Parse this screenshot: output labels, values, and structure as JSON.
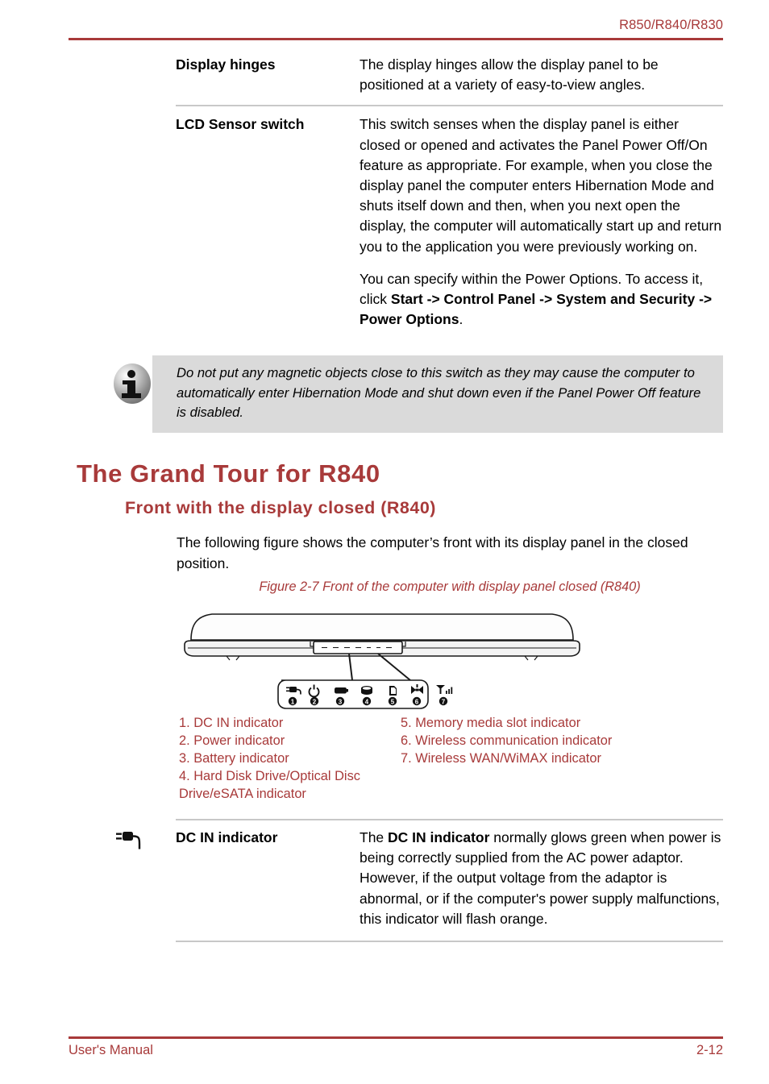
{
  "header": {
    "model_line": "R850/R840/R830",
    "accent_color": "#a83a3a"
  },
  "spec_table": {
    "rows": [
      {
        "term": "Display hinges",
        "paragraphs": [
          {
            "segments": [
              {
                "text": "The display hinges allow the display panel to be positioned at a variety of easy-to-view angles.",
                "bold": false
              }
            ]
          }
        ]
      },
      {
        "term": "LCD Sensor switch",
        "paragraphs": [
          {
            "segments": [
              {
                "text": "This switch senses when the display panel is either closed or opened and activates the Panel Power Off/On feature as appropriate. For example, when you close the display panel the computer enters Hibernation Mode and shuts itself down and then, when you next open the display, the computer will automatically start up and return you to the application you were previously working on.",
                "bold": false
              }
            ]
          },
          {
            "segments": [
              {
                "text": "You can specify within the Power Options. To access it, click ",
                "bold": false
              },
              {
                "text": "Start -> Control Panel -> System and Security -> Power Options",
                "bold": true
              },
              {
                "text": ".",
                "bold": false
              }
            ]
          }
        ]
      }
    ]
  },
  "note": {
    "icon": "info-icon",
    "background_color": "#dadada",
    "text": "Do not put any magnetic objects close to this switch as they may cause the computer to automatically enter Hibernation Mode and shut down even if the Panel Power Off feature is disabled."
  },
  "headings": {
    "h1": "The Grand Tour for R840",
    "h2": "Front with the display closed (R840)"
  },
  "intro": "The following figure shows the computer’s front with its display panel in the closed position.",
  "figure": {
    "caption": "Figure 2-7 Front of the computer with display panel closed (R840)",
    "indicator_icons": [
      {
        "number": "1",
        "icon": "ac-plug-icon"
      },
      {
        "number": "2",
        "icon": "power-icon"
      },
      {
        "number": "3",
        "icon": "battery-icon"
      },
      {
        "number": "4",
        "icon": "hard-disk-icon"
      },
      {
        "number": "5",
        "icon": "memory-card-icon"
      },
      {
        "number": "6",
        "icon": "wireless-icon"
      },
      {
        "number": "7",
        "icon": "signal-bars-icon"
      }
    ]
  },
  "legend": {
    "left_column": [
      "1. DC IN indicator",
      "2. Power indicator",
      "3. Battery indicator",
      "4. Hard Disk Drive/Optical Disc Drive/eSATA indicator"
    ],
    "right_column": [
      "5. Memory media slot indicator",
      "6. Wireless communication indicator",
      "7. Wireless WAN/WiMAX indicator"
    ]
  },
  "bottom_entry": {
    "icon": "ac-plug-icon",
    "term": "DC IN indicator",
    "segments": [
      {
        "text": "The ",
        "bold": false
      },
      {
        "text": "DC IN indicator",
        "bold": true
      },
      {
        "text": " normally glows green when power is being correctly supplied from the AC power adaptor. However, if the output voltage from the adaptor is abnormal, or if the computer's power supply malfunctions, this indicator will flash orange.",
        "bold": false
      }
    ]
  },
  "footer": {
    "left": "User's Manual",
    "right": "2-12"
  }
}
